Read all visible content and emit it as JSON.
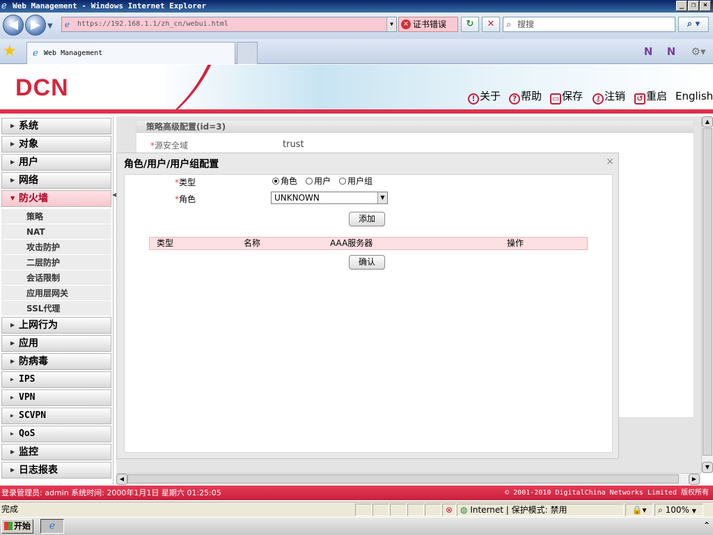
{
  "window": {
    "title": "Web Management - Windows Internet Explorer",
    "buttons": [
      "_",
      "❐",
      "×"
    ]
  },
  "browser": {
    "url": "https://192.168.1.1/zh_cn/webui.html",
    "cert_error": "证书错误",
    "search_placeholder": "搜搜",
    "tab_title": "Web Management"
  },
  "app": {
    "logo": "DCN",
    "top_links": [
      "关于",
      "帮助",
      "保存",
      "注销",
      "重启",
      "English"
    ]
  },
  "sidebar": {
    "items": [
      {
        "label": "系统",
        "active": false
      },
      {
        "label": "对象",
        "active": false
      },
      {
        "label": "用户",
        "active": false
      },
      {
        "label": "网络",
        "active": false
      },
      {
        "label": "防火墙",
        "active": true
      },
      {
        "label": "上网行为",
        "active": false
      },
      {
        "label": "应用",
        "active": false
      },
      {
        "label": "防病毒",
        "active": false
      },
      {
        "label": "IPS",
        "active": false
      },
      {
        "label": "VPN",
        "active": false
      },
      {
        "label": "SCVPN",
        "active": false
      },
      {
        "label": "QoS",
        "active": false
      },
      {
        "label": "监控",
        "active": false
      },
      {
        "label": "日志报表",
        "active": false
      }
    ],
    "subitems": [
      "策略",
      "NAT",
      "攻击防护",
      "二层防护",
      "会话限制",
      "应用层网关",
      "SSL代理"
    ]
  },
  "background_panel": {
    "title": "策略高级配置(id=3)",
    "field_label": "源安全域",
    "field_value": "trust"
  },
  "dialog": {
    "title": "角色/用户/用户组配置",
    "type_label": "类型",
    "type_options": [
      "角色",
      "用户",
      "用户组"
    ],
    "type_selected": "角色",
    "role_label": "角色",
    "role_value": "UNKNOWN",
    "add_button": "添加",
    "confirm_button": "确认",
    "table_headers": [
      "类型",
      "名称",
      "AAA服务器",
      "操作"
    ]
  },
  "footer": {
    "left": "登录管理员: admin 系统时间: 2000年1月1日 星期六 01:25:05",
    "right": "© 2001-2010 DigitalChina Networks Limited 版权所有"
  },
  "statusbar": {
    "status": "完成",
    "zone": "Internet | 保护模式: 禁用",
    "zoom": "100%"
  },
  "taskbar": {
    "start": "开始"
  }
}
